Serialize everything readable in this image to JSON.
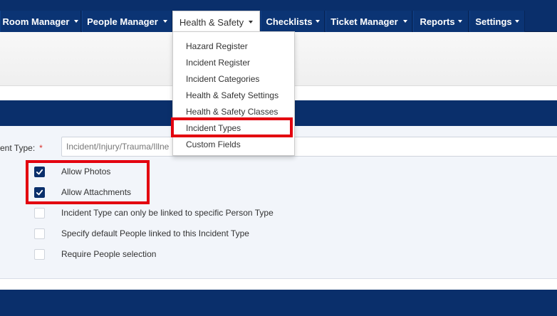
{
  "nav": {
    "items": [
      {
        "label": "Room Manager",
        "active": false
      },
      {
        "label": "People Manager",
        "active": false
      },
      {
        "label": "Health & Safety",
        "active": true
      },
      {
        "label": "Checklists",
        "active": false
      },
      {
        "label": "Ticket Manager",
        "active": false
      },
      {
        "label": "Reports",
        "active": false
      },
      {
        "label": "Settings",
        "active": false
      }
    ]
  },
  "dropdown": {
    "items": [
      "Hazard Register",
      "Incident Register",
      "Incident Categories",
      "Health & Safety Settings",
      "Health & Safety Classes",
      "Incident Types",
      "Custom Fields"
    ],
    "highlighted": "Incident Types"
  },
  "form": {
    "field_label": "ent Type:",
    "required_mark": "*",
    "field_value": "Incident/Injury/Trauma/Illne",
    "checkboxes": [
      {
        "label": "Allow Photos",
        "checked": true
      },
      {
        "label": "Allow Attachments",
        "checked": true
      },
      {
        "label": "Incident Type can only be linked to specific Person Type",
        "checked": false
      },
      {
        "label": "Specify default People linked to this Incident Type",
        "checked": false
      },
      {
        "label": "Require People selection",
        "checked": false
      }
    ]
  },
  "colors": {
    "navy": "#0a2f6b",
    "highlight_red": "#e3000f",
    "required_red": "#d9302c"
  },
  "icons": {
    "caret": "caret-down-icon",
    "check": "checkmark-icon"
  }
}
